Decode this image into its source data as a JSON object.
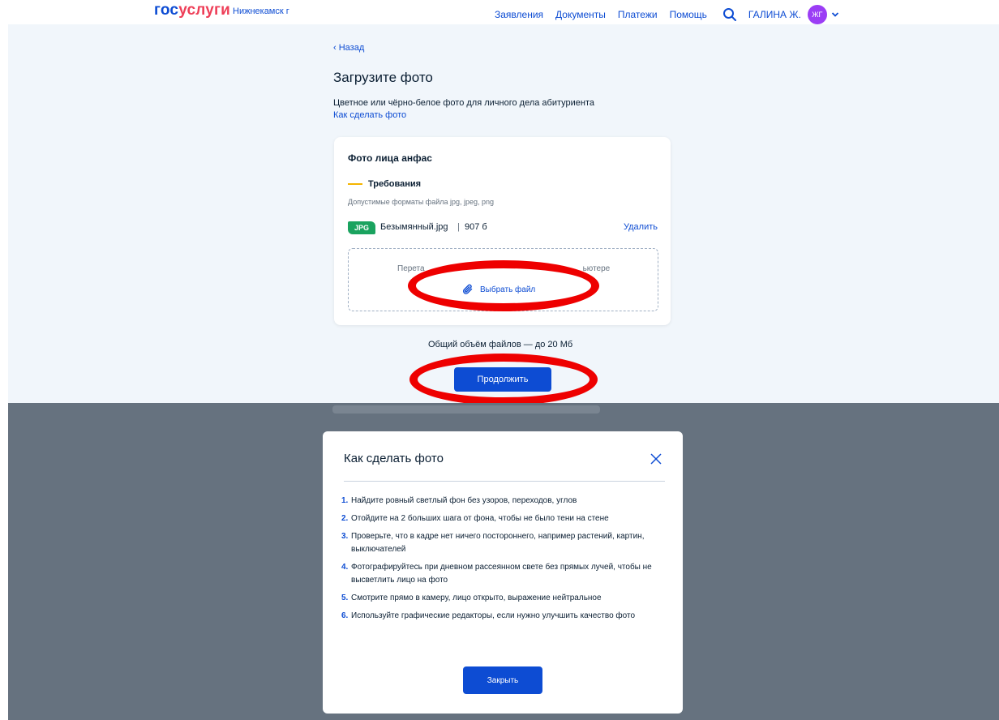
{
  "header": {
    "logo_part1": "гос",
    "logo_part2": "услуги",
    "city": "Нижнекамск г",
    "nav": [
      "Заявления",
      "Документы",
      "Платежи",
      "Помощь"
    ],
    "user_name": "ГАЛИНА Ж.",
    "avatar_initials": "ЖГ"
  },
  "page": {
    "back": "‹ Назад",
    "title": "Загрузите фото",
    "description": "Цветное или чёрно-белое фото для личного дела абитуриента",
    "how_link": "Как сделать фото"
  },
  "card": {
    "title": "Фото лица анфас",
    "requirements": "Требования",
    "formats": "Допустимые форматы файла jpg, jpeg, png",
    "file": {
      "badge": "JPG",
      "name": "Безымянный.jpg",
      "separator": "|",
      "size": "907 б",
      "delete": "Удалить"
    },
    "drop_visible_left": "Перета",
    "drop_visible_right": "ьютере",
    "choose_file": "Выбрать файл"
  },
  "total_size": "Общий объём файлов — до 20 Мб",
  "continue_button": "Продолжить",
  "modal": {
    "title": "Как сделать фото",
    "steps": [
      {
        "num": "1.",
        "text": "Найдите ровный светлый фон без узоров, переходов, углов"
      },
      {
        "num": "2.",
        "text": "Отойдите на 2 больших шага от фона, чтобы не было тени на стене"
      },
      {
        "num": "3.",
        "text": "Проверьте, что в кадре нет ничего постороннего, например растений, картин, выключателей"
      },
      {
        "num": "4.",
        "text": "Фотографируйтесь при дневном рассеянном свете без прямых лучей, чтобы не высветлить лицо на фото"
      },
      {
        "num": "5.",
        "text": "Смотрите прямо в камеру, лицо открыто, выражение нейтральное"
      },
      {
        "num": "6.",
        "text": "Используйте графические редакторы, если нужно улучшить качество фото"
      }
    ],
    "close_button": "Закрыть"
  },
  "colors": {
    "primary": "#0d4cd3",
    "annotation_red": "#ee0000",
    "badge_green": "#1aa35f",
    "requirements_accent": "#f4b400",
    "overlay": "#66727f"
  }
}
